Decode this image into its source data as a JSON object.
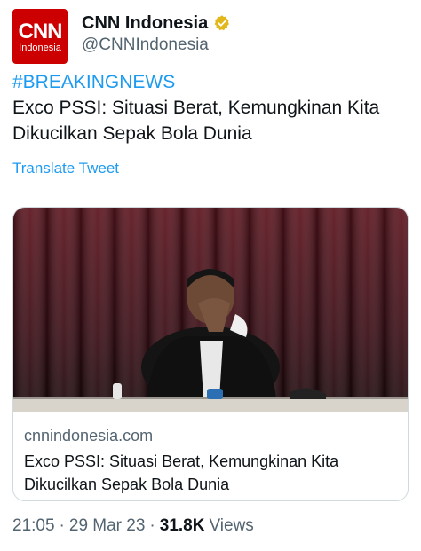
{
  "account": {
    "avatar_logo": "CNN",
    "avatar_sub": "Indonesia",
    "display_name": "CNN Indonesia",
    "handle": "@CNNIndonesia",
    "verified_color": "#e2b719"
  },
  "tweet": {
    "hashtag": "#BREAKINGNEWS",
    "text": "Exco PSSI: Situasi Berat, Kemungkinan Kita Dikucilkan Sepak Bola Dunia",
    "translate_label": "Translate Tweet"
  },
  "link_card": {
    "domain": "cnnindonesia.com",
    "title": "Exco PSSI: Situasi Berat, Kemungkinan Kita Dikucilkan Sepak Bola Dunia"
  },
  "meta": {
    "time": "21:05",
    "separator": "·",
    "date": "29 Mar 23",
    "views_count": "31.8K",
    "views_label": "Views"
  },
  "colors": {
    "link": "#1d9bf0",
    "brand": "#cc0000",
    "secondary_text": "#536471"
  }
}
